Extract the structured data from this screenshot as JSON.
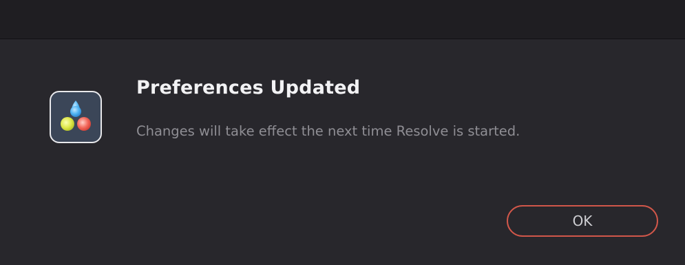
{
  "dialog": {
    "title": "Preferences Updated",
    "message": "Changes will take effect the next time Resolve is started.",
    "ok_label": "OK",
    "icon": "davinci-resolve-icon"
  },
  "colors": {
    "accent_border": "#d2574a",
    "background": "#28272c",
    "title_text": "#f2f2f4",
    "message_text": "#8f8e94"
  }
}
